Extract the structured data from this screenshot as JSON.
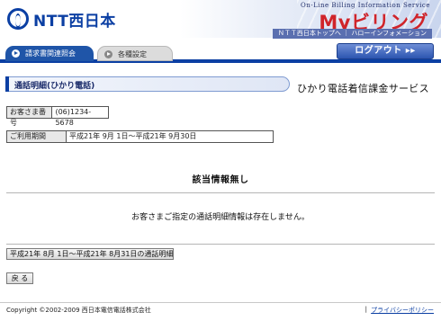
{
  "header": {
    "logo_text": "NTT西日本",
    "banner_subtitle": "On-Line Billing Information Service",
    "banner_title": "Myビリング",
    "banner_links": "ＮＴＴ西日本トップへ ｜ ハローインフォメーション"
  },
  "tabs": [
    {
      "label": "請求書関連照会",
      "active": true
    },
    {
      "label": "各種設定",
      "active": false
    }
  ],
  "logout_label": "ログアウト ▸▸",
  "section": {
    "heading": "通話明細(ひかり電話)",
    "service_name": "ひかり電話着信課金サービス"
  },
  "customer": {
    "label": "お客さま番号",
    "value": "(06)1234-5678"
  },
  "period": {
    "label": "ご利用期間",
    "value": "平成21年  9月  1日〜平成21年  9月30日"
  },
  "no_data": {
    "title": "該当情報無し",
    "message": "お客さまご指定の通話明細情報は存在しません。"
  },
  "buttons": {
    "period_link": "平成21年 8月 1日〜平成21年 8月31日の通話明細",
    "back": "戻 る"
  },
  "footer": {
    "copyright": "Copyright ©2002-2009 西日本電信電話株式会社",
    "separator": "|",
    "privacy": "プライバシーポリシー"
  },
  "colors": {
    "brand_blue": "#0b3fa3",
    "banner_red": "#d0242a"
  }
}
